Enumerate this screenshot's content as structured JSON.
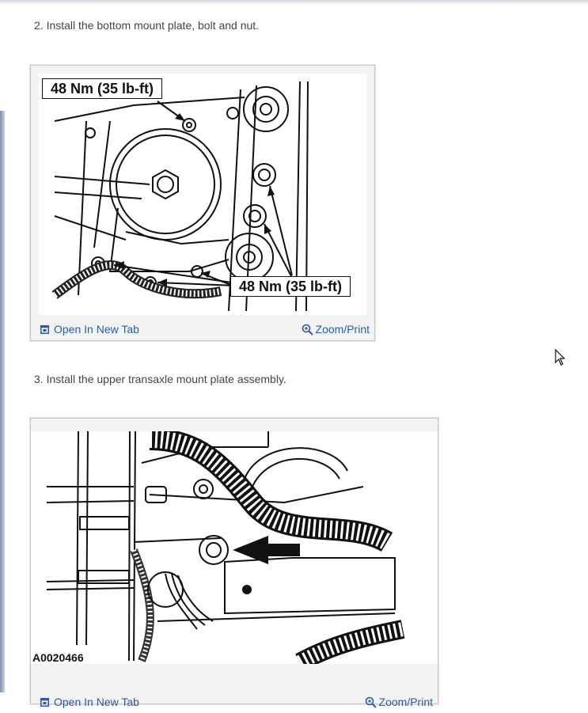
{
  "steps": [
    {
      "text": "2. Install the bottom mount plate, bolt and nut.",
      "callouts": [
        "48 Nm (35 lb-ft)",
        "48 Nm (35 lb-ft)"
      ],
      "open_label": "Open In New Tab",
      "zoom_label": "Zoom/Print"
    },
    {
      "text": "3. Install the upper transaxle mount plate assembly.",
      "figure_id": "A0020466",
      "open_label": "Open In New Tab",
      "zoom_label": "Zoom/Print"
    }
  ],
  "colors": {
    "link": "#2a5aa8",
    "frame_bg": "#f3f3f3",
    "frame_border": "#c6c6c6"
  }
}
